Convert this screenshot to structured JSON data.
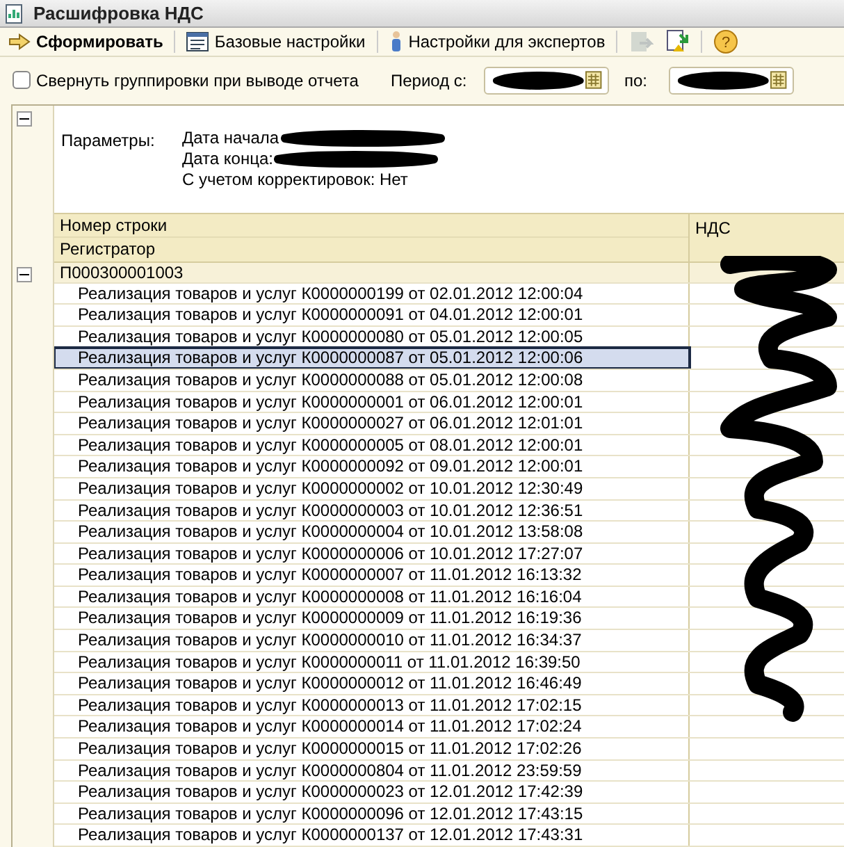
{
  "window": {
    "title": "Расшифровка НДС"
  },
  "toolbar": [
    {
      "label": "Сформировать",
      "kind": "generate"
    },
    {
      "label": "Базовые настройки",
      "kind": "settings"
    },
    {
      "label": "Настройки для экспертов",
      "kind": "expert"
    },
    {
      "kind": "save",
      "disabled": true
    },
    {
      "kind": "load",
      "disabled": false
    },
    {
      "kind": "help",
      "disabled": false,
      "symbol": "?"
    }
  ],
  "collapse_option": {
    "label": "Свернуть группировки при выводе отчета",
    "checked": false
  },
  "period": {
    "from_label": "Период с:",
    "to_label": "по:"
  },
  "parameters": {
    "expanded": true,
    "label": "Параметры:",
    "lines": [
      "Дата начала",
      "Дата конца:",
      "С учетом корректировок: Нет"
    ]
  },
  "table": {
    "columns": [
      "Номер строки",
      "Регистратор"
    ],
    "value_column": "НДС",
    "group": {
      "label": "П000300001003",
      "expanded": true
    },
    "rows": [
      {
        "text": "Реализация товаров и услуг К0000000199 от 02.01.2012 12:00:04",
        "selected": false
      },
      {
        "text": "Реализация товаров и услуг К0000000091 от 04.01.2012 12:00:01",
        "selected": false
      },
      {
        "text": "Реализация товаров и услуг К0000000080 от 05.01.2012 12:00:05",
        "selected": false
      },
      {
        "text": "Реализация товаров и услуг К0000000087 от 05.01.2012 12:00:06",
        "selected": true
      },
      {
        "text": "Реализация товаров и услуг К0000000088 от 05.01.2012 12:00:08",
        "selected": false
      },
      {
        "text": "Реализация товаров и услуг К0000000001 от 06.01.2012 12:00:01",
        "selected": false
      },
      {
        "text": "Реализация товаров и услуг К0000000027 от 06.01.2012 12:01:01",
        "selected": false
      },
      {
        "text": "Реализация товаров и услуг К0000000005 от 08.01.2012 12:00:01",
        "selected": false
      },
      {
        "text": "Реализация товаров и услуг К0000000092 от 09.01.2012 12:00:01",
        "selected": false
      },
      {
        "text": "Реализация товаров и услуг К0000000002 от 10.01.2012 12:30:49",
        "selected": false
      },
      {
        "text": "Реализация товаров и услуг К0000000003 от 10.01.2012 12:36:51",
        "selected": false
      },
      {
        "text": "Реализация товаров и услуг К0000000004 от 10.01.2012 13:58:08",
        "selected": false
      },
      {
        "text": "Реализация товаров и услуг К0000000006 от 10.01.2012 17:27:07",
        "selected": false
      },
      {
        "text": "Реализация товаров и услуг К0000000007 от 11.01.2012 16:13:32",
        "selected": false
      },
      {
        "text": "Реализация товаров и услуг К0000000008 от 11.01.2012 16:16:04",
        "selected": false
      },
      {
        "text": "Реализация товаров и услуг К0000000009 от 11.01.2012 16:19:36",
        "selected": false
      },
      {
        "text": "Реализация товаров и услуг К0000000010 от 11.01.2012 16:34:37",
        "selected": false
      },
      {
        "text": "Реализация товаров и услуг К0000000011 от 11.01.2012 16:39:50",
        "selected": false
      },
      {
        "text": "Реализация товаров и услуг К0000000012 от 11.01.2012 16:46:49",
        "selected": false
      },
      {
        "text": "Реализация товаров и услуг К0000000013 от 11.01.2012 17:02:15",
        "selected": false
      },
      {
        "text": "Реализация товаров и услуг К0000000014 от 11.01.2012 17:02:24",
        "selected": false
      },
      {
        "text": "Реализация товаров и услуг К0000000015 от 11.01.2012 17:02:26",
        "selected": false
      },
      {
        "text": "Реализация товаров и услуг К0000000804 от 11.01.2012 23:59:59",
        "selected": false
      },
      {
        "text": "Реализация товаров и услуг К0000000023 от 12.01.2012 17:42:39",
        "selected": false
      },
      {
        "text": "Реализация товаров и услуг К0000000096 от 12.01.2012 17:43:15",
        "selected": false
      },
      {
        "text": "Реализация товаров и услуг К0000000137 от 12.01.2012 17:43:31",
        "selected": false
      }
    ]
  }
}
